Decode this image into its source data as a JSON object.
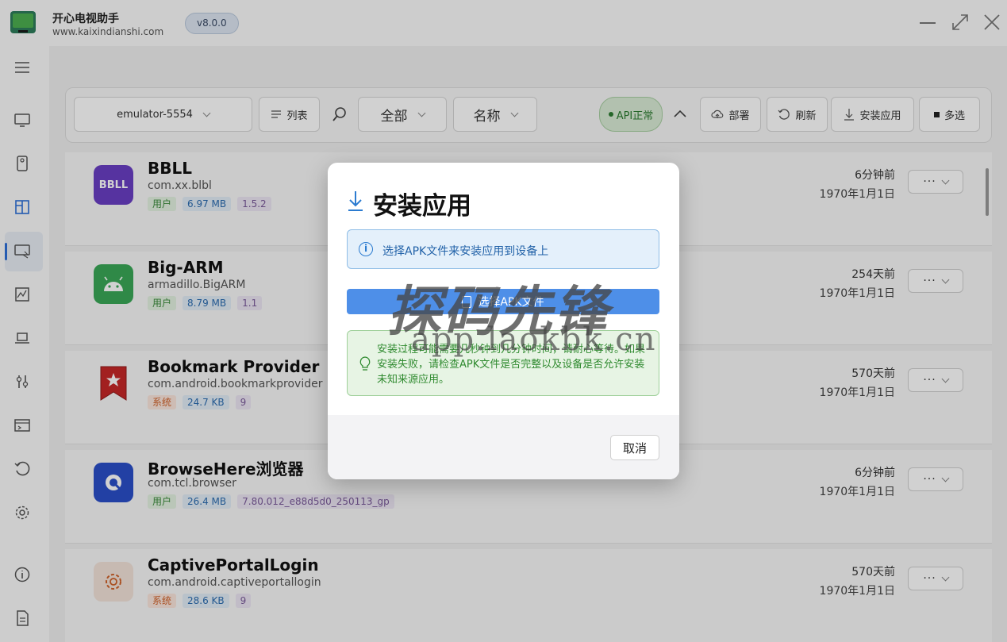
{
  "app": {
    "title": "开心电视助手",
    "url": "www.kaixindianshi.com",
    "version": "v8.0.0"
  },
  "toolbar": {
    "device": "emulator-5554",
    "view_mode": "列表",
    "filter": "全部",
    "sort": "名称",
    "api_status": "API正常",
    "deploy": "部署",
    "refresh": "刷新",
    "install": "安装应用",
    "multiselect": "多选"
  },
  "apps": [
    {
      "name": "BBLL",
      "package": "com.xx.blbl",
      "type": "用户",
      "size": "6.97 MB",
      "version": "1.5.2",
      "time": "6分钟前",
      "date": "1970年1月1日",
      "icon_text": "BBLL",
      "icon_color": "#6a3fc4"
    },
    {
      "name": "Big-ARM",
      "package": "armadillo.BigARM",
      "type": "用户",
      "size": "8.79 MB",
      "version": "1.1",
      "time": "254天前",
      "date": "1970年1月1日",
      "icon_color": "#3aa857"
    },
    {
      "name": "Bookmark Provider",
      "package": "com.android.bookmarkprovider",
      "type": "系统",
      "size": "24.7 KB",
      "version": "9",
      "time": "570天前",
      "date": "1970年1月1日",
      "icon_color": "#c62828"
    },
    {
      "name": "BrowseHere浏览器",
      "package": "com.tcl.browser",
      "type": "用户",
      "size": "26.4 MB",
      "version": "7.80.012_e88d5d0_250113_gp",
      "time": "6分钟前",
      "date": "1970年1月1日",
      "icon_color": "#2a4fc9"
    },
    {
      "name": "CaptivePortalLogin",
      "package": "com.android.captiveportallogin",
      "type": "系统",
      "size": "28.6 KB",
      "version": "9",
      "time": "570天前",
      "date": "1970年1月1日",
      "icon_color": "#f3e3da"
    }
  ],
  "more_label": "···",
  "dialog": {
    "title": "安装应用",
    "info": "选择APK文件来安装应用到设备上",
    "select_button": "选择APK文件",
    "tip": "安装过程可能需要几秒钟到几分钟时间，请耐心等待。如果安装失败，请检查APK文件是否完整以及设备是否允许安装未知来源应用。",
    "cancel": "取消"
  },
  "watermark": {
    "main": "探码先锋",
    "url": "app.laokbk.cn"
  }
}
